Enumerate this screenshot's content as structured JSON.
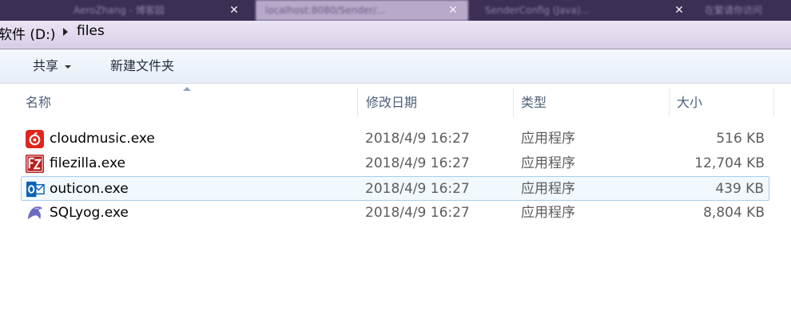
{
  "browser_tabs": [
    {
      "title": "AeroZhang - 博客园",
      "active": false
    },
    {
      "title": "localhost:8080/Sender/...",
      "active": true
    },
    {
      "title": "SenderConfig (Java)...",
      "active": false
    },
    {
      "title": "在繁请你访问",
      "active": false
    }
  ],
  "tab_close_glyph": "✕",
  "address_bar": {
    "drive": "软件 (D:)",
    "folder": "files"
  },
  "toolbar": {
    "share_label": "共享",
    "new_folder_label": "新建文件夹"
  },
  "columns": {
    "name": "名称",
    "date": "修改日期",
    "type": "类型",
    "size": "大小"
  },
  "files": [
    {
      "name": "cloudmusic.exe",
      "date": "2018/4/9 16:27",
      "type": "应用程序",
      "size": "516 KB",
      "icon": "cloudmusic-icon",
      "icon_color": "#e0261c",
      "selected": false
    },
    {
      "name": "filezilla.exe",
      "date": "2018/4/9 16:27",
      "type": "应用程序",
      "size": "12,704 KB",
      "icon": "filezilla-icon",
      "icon_color": "#b81d1d",
      "selected": false
    },
    {
      "name": "outicon.exe",
      "date": "2018/4/9 16:27",
      "type": "应用程序",
      "size": "439 KB",
      "icon": "outlook-icon",
      "icon_color": "#0a64b5",
      "selected": true
    },
    {
      "name": "SQLyog.exe",
      "date": "2018/4/9 16:27",
      "type": "应用程序",
      "size": "8,804 KB",
      "icon": "sqlyog-icon",
      "icon_color": "#6b6bc6",
      "selected": false
    }
  ]
}
